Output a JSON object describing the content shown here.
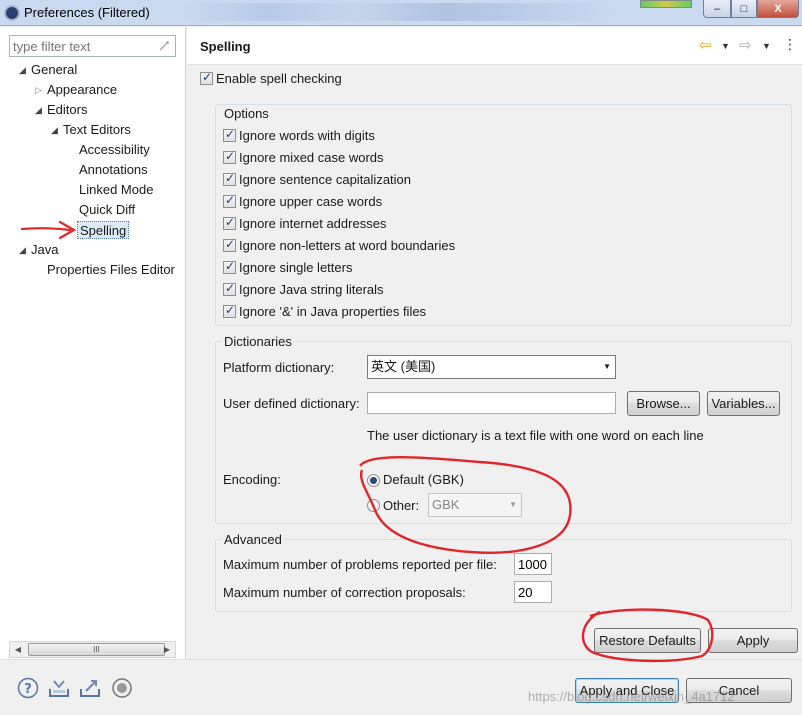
{
  "window": {
    "title": "Preferences (Filtered)",
    "minimize": "‒",
    "maximize": "□",
    "close": "X"
  },
  "filter": {
    "placeholder": "type filter text"
  },
  "tree": {
    "general": "General",
    "appearance": "Appearance",
    "editors": "Editors",
    "text_editors": "Text Editors",
    "accessibility": "Accessibility",
    "annotations": "Annotations",
    "linked_mode": "Linked Mode",
    "quick_diff": "Quick Diff",
    "spelling": "Spelling",
    "java": "Java",
    "properties_files_editor": "Properties Files Editor"
  },
  "page": {
    "title": "Spelling",
    "enable_spell_checking": "Enable spell checking",
    "options": {
      "title": "Options",
      "items": [
        "Ignore words with digits",
        "Ignore mixed case words",
        "Ignore sentence capitalization",
        "Ignore upper case words",
        "Ignore internet addresses",
        "Ignore non-letters at word boundaries",
        "Ignore single letters",
        "Ignore Java string literals",
        "Ignore '&' in Java properties files"
      ]
    },
    "dictionaries": {
      "title": "Dictionaries",
      "platform_label": "Platform dictionary:",
      "platform_value": "英文 (美国)",
      "user_label": "User defined dictionary:",
      "user_value": "",
      "browse": "Browse...",
      "variables": "Variables...",
      "hint": "The user dictionary is a text file with one word on each line",
      "encoding_label": "Encoding:",
      "default_encoding": "Default (GBK)",
      "other_label": "Other:",
      "other_value": "GBK"
    },
    "advanced": {
      "title": "Advanced",
      "max_problems_label": "Maximum number of problems reported per file:",
      "max_problems_value": "1000",
      "max_proposals_label": "Maximum number of correction proposals:",
      "max_proposals_value": "20"
    },
    "restore_defaults": "Restore Defaults",
    "apply": "Apply"
  },
  "bottom": {
    "apply_and_close": "Apply and Close",
    "cancel": "Cancel",
    "watermark": "https://blog.csdn.net/weixin_4a1712"
  },
  "scroll": {
    "thumb": "III"
  },
  "colors": {
    "annotation_red": "#e0262b",
    "accent": "#3c7fb1"
  }
}
